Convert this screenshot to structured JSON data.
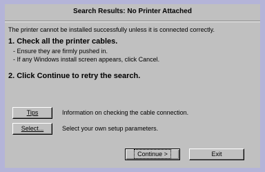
{
  "dialog": {
    "title": "Search Results: No Printer Attached",
    "intro": "The printer cannot be installed successfully unless it is connected correctly.",
    "step1": {
      "heading": "1. Check all the printer cables.",
      "bullets": [
        "- Ensure they are firmly pushed in.",
        "- If any Windows install screen appears, click Cancel."
      ]
    },
    "step2": {
      "heading": "2. Click Continue to retry the search."
    },
    "options": [
      {
        "button": "Tips",
        "description": "Information on checking the cable connection."
      },
      {
        "button": "Select...",
        "description": "Select your own setup parameters."
      }
    ],
    "footer": {
      "continue_label": "Continue >",
      "exit_label": "Exit"
    }
  },
  "colors": {
    "dialog_bg": "#c0c0c0",
    "frame": "#b4b4d8"
  }
}
